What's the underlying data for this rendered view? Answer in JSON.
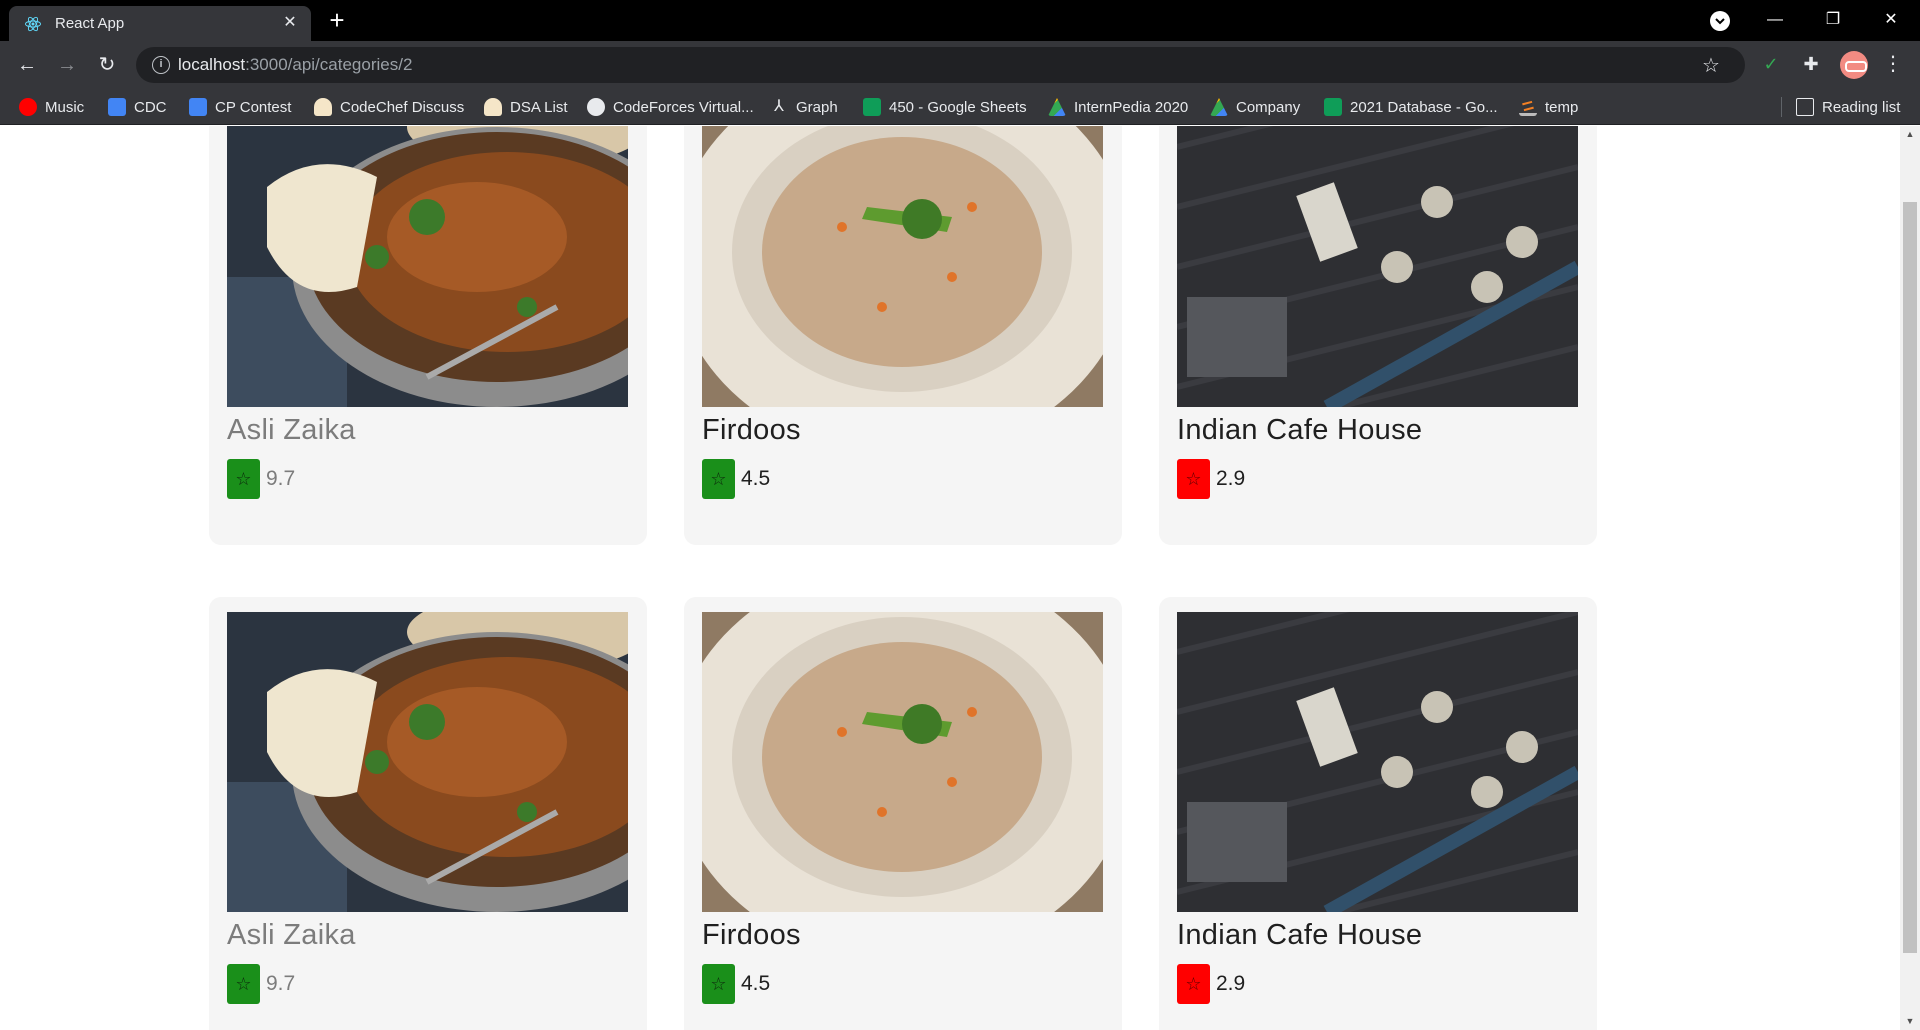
{
  "browser": {
    "tab": {
      "title": "React App",
      "favicon": "react-icon"
    },
    "url": {
      "host": "localhost",
      "path": ":3000/api/categories/2"
    },
    "bookmarks": [
      {
        "label": "Music",
        "icon": "youtube-music-icon",
        "color": "#ff0000"
      },
      {
        "label": "CDC",
        "icon": "google-docs-icon",
        "color": "#4285f4"
      },
      {
        "label": "CP Contest",
        "icon": "google-calendar-icon",
        "color": "#4285f4"
      },
      {
        "label": "CodeChef Discuss",
        "icon": "codechef-icon",
        "color": "#f5e6c8"
      },
      {
        "label": "DSA List",
        "icon": "codechef-icon",
        "color": "#f5e6c8"
      },
      {
        "label": "CodeForces Virtual...",
        "icon": "globe-icon",
        "color": "#e8eaed"
      },
      {
        "label": "Graph",
        "icon": "graph-icon",
        "color": "#e8eaed"
      },
      {
        "label": "450 - Google Sheets",
        "icon": "google-sheets-icon",
        "color": "#0f9d58"
      },
      {
        "label": "InternPedia 2020",
        "icon": "google-drive-icon",
        "color": "#fbbc04"
      },
      {
        "label": "Company",
        "icon": "google-drive-icon",
        "color": "#fbbc04"
      },
      {
        "label": "2021 Database - Go...",
        "icon": "google-sheets-icon",
        "color": "#0f9d58"
      },
      {
        "label": "temp",
        "icon": "stackoverflow-icon",
        "color": "#f48024"
      }
    ],
    "reading_list": "Reading list"
  },
  "restaurants": [
    {
      "name": "Asli Zaika",
      "rating": "9.7",
      "badge_color": "#1a8f1a",
      "muted": true,
      "image": "curry-dish"
    },
    {
      "name": "Firdoos",
      "rating": "4.5",
      "badge_color": "#1a8f1a",
      "muted": false,
      "image": "rice-bowl"
    },
    {
      "name": "Indian Cafe House",
      "rating": "2.9",
      "badge_color": "#ff0000",
      "muted": false,
      "image": "cafe-interior"
    },
    {
      "name": "Asli Zaika",
      "rating": "9.7",
      "badge_color": "#1a8f1a",
      "muted": true,
      "image": "curry-dish"
    },
    {
      "name": "Firdoos",
      "rating": "4.5",
      "badge_color": "#1a8f1a",
      "muted": false,
      "image": "rice-bowl"
    },
    {
      "name": "Indian Cafe House",
      "rating": "2.9",
      "badge_color": "#ff0000",
      "muted": false,
      "image": "cafe-interior"
    }
  ]
}
